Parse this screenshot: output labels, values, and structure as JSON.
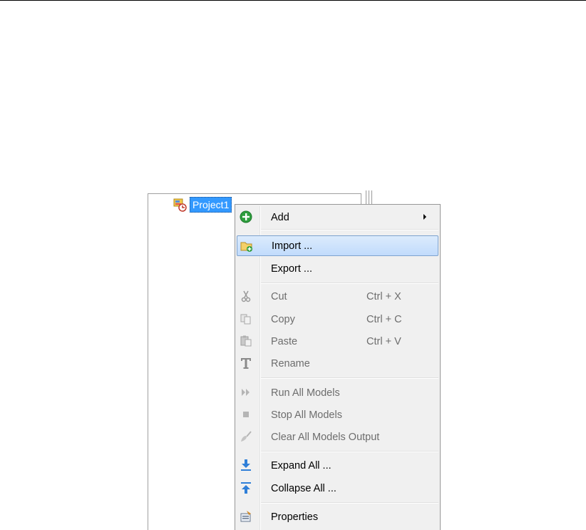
{
  "tree": {
    "node_label": "Project1"
  },
  "menu": {
    "items": [
      {
        "label": "Add",
        "shortcut": "",
        "icon": "add-icon",
        "enabled": true,
        "submenu": true
      },
      {
        "label": "Import ...",
        "shortcut": "",
        "icon": "import-folder-icon",
        "enabled": true,
        "highlighted": true
      },
      {
        "label": "Export ...",
        "shortcut": "",
        "icon": "",
        "enabled": true
      },
      {
        "label": "Cut",
        "shortcut": "Ctrl + X",
        "icon": "scissors-icon",
        "enabled": false
      },
      {
        "label": "Copy",
        "shortcut": "Ctrl + C",
        "icon": "copy-icon",
        "enabled": false
      },
      {
        "label": "Paste",
        "shortcut": "Ctrl + V",
        "icon": "paste-icon",
        "enabled": false
      },
      {
        "label": "Rename",
        "shortcut": "",
        "icon": "rename-icon",
        "enabled": false
      },
      {
        "label": "Run All Models",
        "shortcut": "",
        "icon": "run-icon",
        "enabled": false
      },
      {
        "label": "Stop All Models",
        "shortcut": "",
        "icon": "stop-icon",
        "enabled": false
      },
      {
        "label": "Clear All Models Output",
        "shortcut": "",
        "icon": "clear-brush-icon",
        "enabled": false
      },
      {
        "label": "Expand All ...",
        "shortcut": "",
        "icon": "expand-all-icon",
        "enabled": true
      },
      {
        "label": "Collapse All ...",
        "shortcut": "",
        "icon": "collapse-all-icon",
        "enabled": true
      },
      {
        "label": "Properties",
        "shortcut": "",
        "icon": "properties-icon",
        "enabled": true
      }
    ]
  },
  "colors": {
    "selection": "#3399ff",
    "menu_background": "#f0f0f0",
    "highlight_border": "#7da2ce",
    "disabled_text": "#6d6d6d"
  }
}
